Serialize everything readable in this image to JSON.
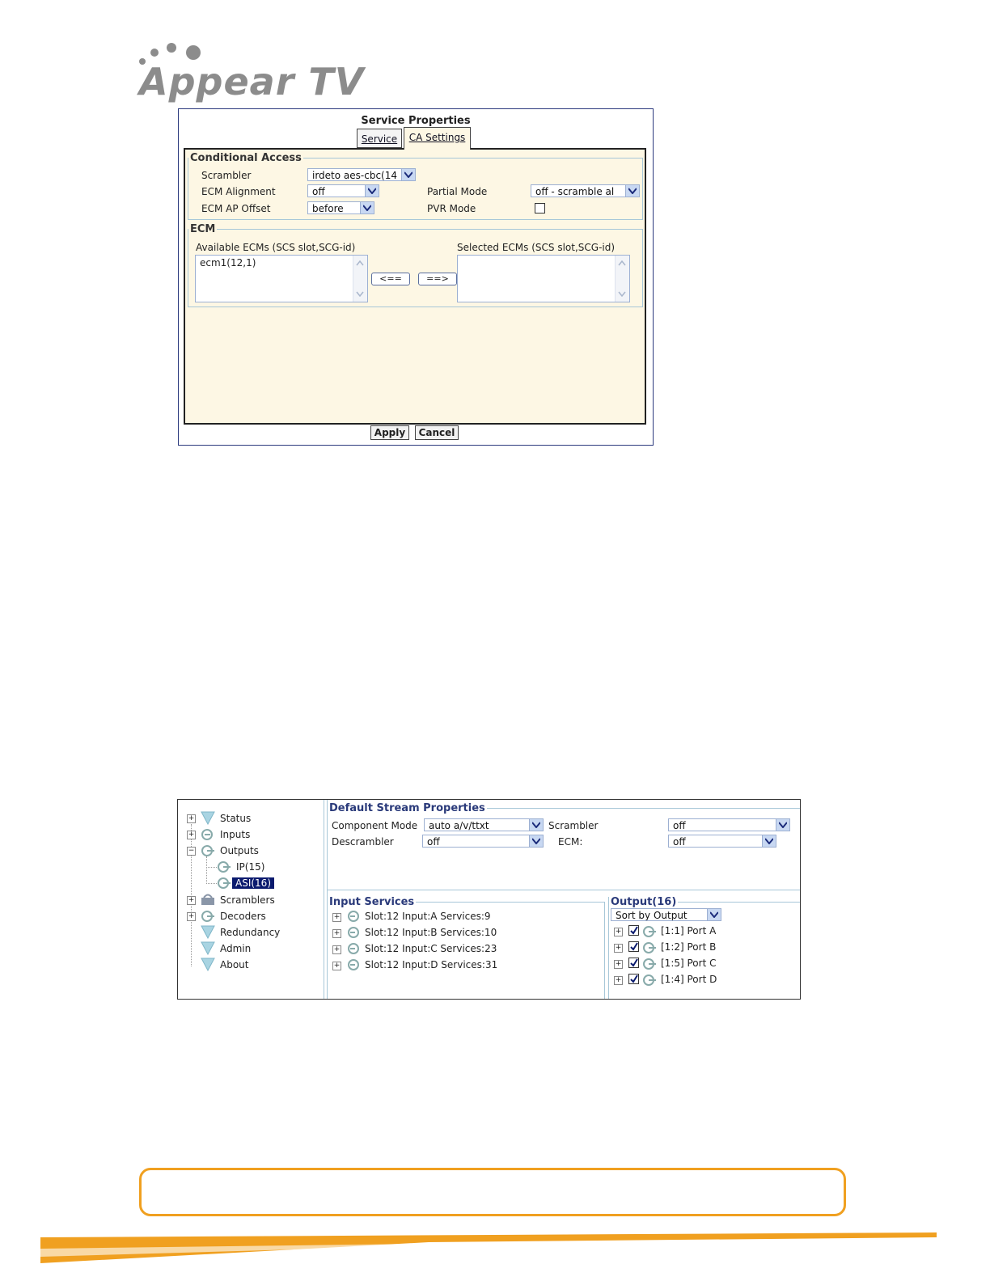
{
  "brand": {
    "name": "Appear TV"
  },
  "service_dialog": {
    "title": "Service Properties",
    "tabs": [
      {
        "label": "Service"
      },
      {
        "label": "CA Settings"
      }
    ],
    "conditional_access": {
      "legend": "Conditional Access",
      "scrambler_label": "Scrambler",
      "scrambler_value": "irdeto aes-cbc(14",
      "ecm_alignment_label": "ECM Alignment",
      "ecm_alignment_value": "off",
      "partial_mode_label": "Partial Mode",
      "partial_mode_value": "off - scramble al",
      "ecm_ap_offset_label": "ECM AP Offset",
      "ecm_ap_offset_value": "before",
      "pvr_mode_label": "PVR Mode",
      "pvr_mode_checked": false
    },
    "ecm": {
      "legend": "ECM",
      "available_label": "Available ECMs (SCS slot,SCG-id)",
      "available_items": [
        "ecm1(12,1)"
      ],
      "selected_label": "Selected ECMs (SCS slot,SCG-id)",
      "move_left_label": "<==",
      "move_right_label": "==>"
    },
    "apply_label": "Apply",
    "cancel_label": "Cancel"
  },
  "stream_view": {
    "tree": [
      {
        "label": "Status"
      },
      {
        "label": "Inputs"
      },
      {
        "label": "Outputs"
      },
      {
        "label": "IP(15)"
      },
      {
        "label": "ASI(16)"
      },
      {
        "label": "Scramblers"
      },
      {
        "label": "Decoders"
      },
      {
        "label": "Redundancy"
      },
      {
        "label": "Admin"
      },
      {
        "label": "About"
      }
    ],
    "default_props": {
      "legend": "Default Stream Properties",
      "component_mode_label": "Component Mode",
      "component_mode_value": "auto a/v/ttxt",
      "scrambler_label": "Scrambler",
      "scrambler_value": "off",
      "descrambler_label": "Descrambler",
      "descrambler_value": "off",
      "ecm_label": "ECM:",
      "ecm_value": "off"
    },
    "input_services": {
      "legend": "Input Services",
      "items": [
        "Slot:12 Input:A Services:9",
        "Slot:12 Input:B Services:10",
        "Slot:12 Input:C Services:23",
        "Slot:12 Input:D Services:31"
      ]
    },
    "output": {
      "legend": "Output(16)",
      "sort_value": "Sort by Output",
      "items": [
        "[1:1] Port A",
        "[1:2] Port B",
        "[1:5] Port C",
        "[1:4] Port D"
      ]
    }
  },
  "colors": {
    "accent_orange": "#f0a020",
    "header_blue": "#2a3a7a",
    "selected_bg": "#0a1a6e"
  }
}
